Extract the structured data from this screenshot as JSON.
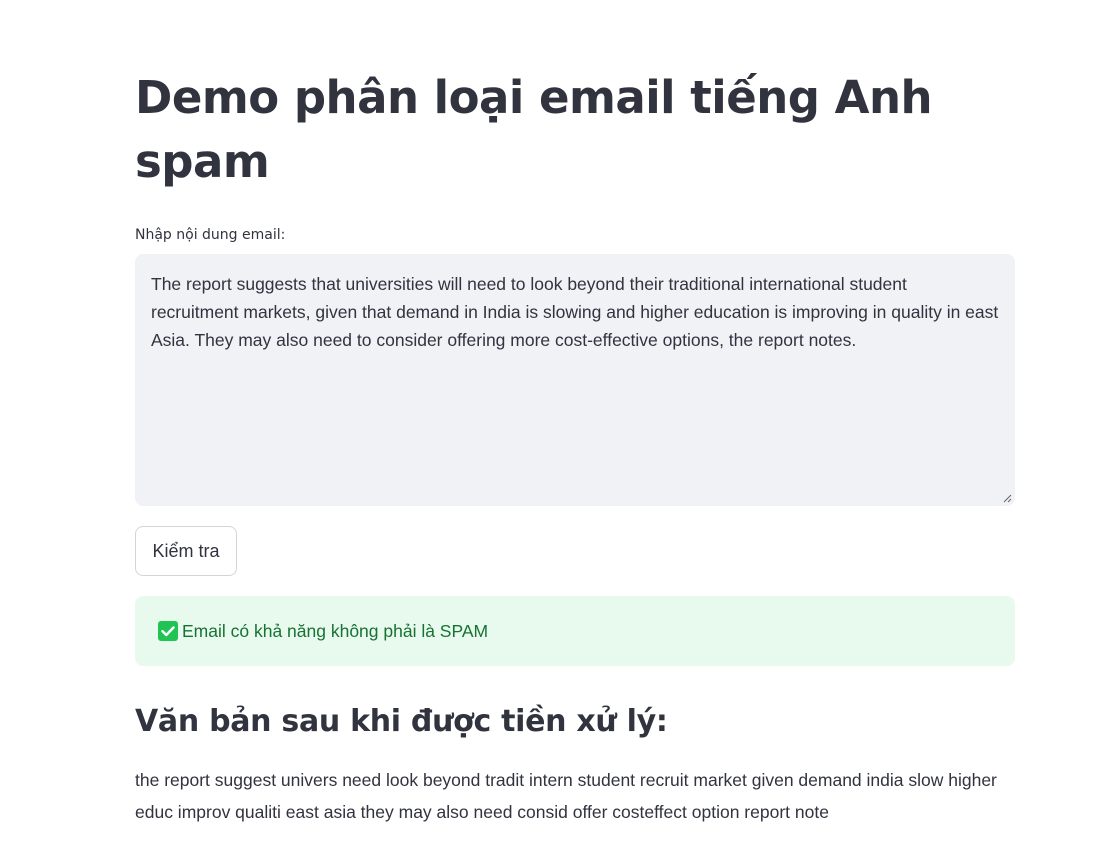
{
  "page": {
    "title": "Demo phân loại email tiếng Anh spam"
  },
  "email_input": {
    "label": "Nhập nội dung email:",
    "value": "The report suggests that universities will need to look beyond their traditional international student recruitment markets, given that demand in India is slowing and higher education is improving in quality in east Asia. They may also need to consider offering more cost-effective options, the report notes."
  },
  "check_button": {
    "label": "Kiểm tra"
  },
  "result": {
    "icon": "check-box-icon",
    "message": "Email có khả năng không phải là SPAM",
    "status_color": "#177233",
    "background_color": "#e8f9ee"
  },
  "processed": {
    "heading": "Văn bản sau khi được tiền xử lý:",
    "text": "the report suggest univers need look beyond tradit intern student recruit market given demand india slow higher educ improv qualiti east asia they may also need consid offer costeffect option report note"
  },
  "colors": {
    "text": "#31333f",
    "input_background": "#f0f2f6",
    "success_icon": "#21c354"
  }
}
